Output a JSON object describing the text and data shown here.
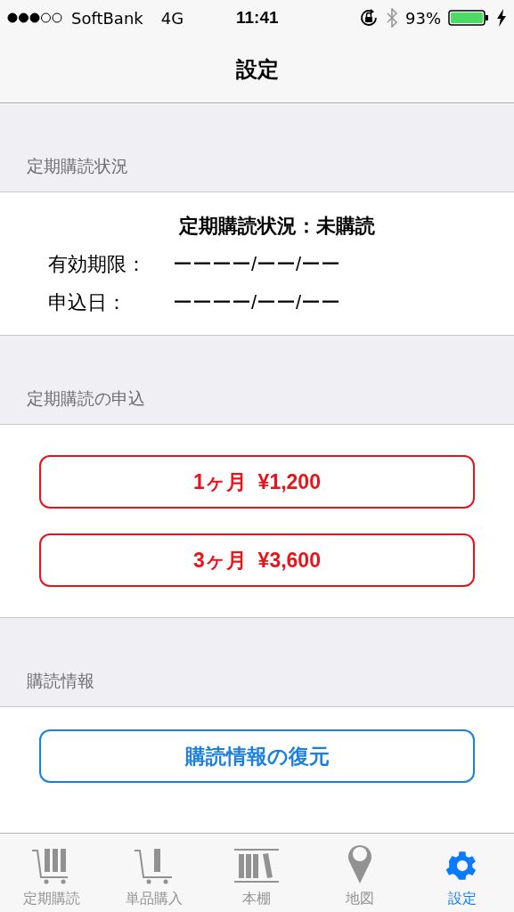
{
  "status_bar": {
    "carrier": "SoftBank",
    "network": "4G",
    "time": "11:41",
    "battery": "93%"
  },
  "nav": {
    "title": "設定"
  },
  "sections": [
    {
      "header": "定期購読状況",
      "kind": "status",
      "title": "定期購読状況：未購読",
      "rows": [
        {
          "label": "有効期限：",
          "value": "ーーーー/ーー/ーー"
        },
        {
          "label": "申込日：",
          "value": "ーーーー/ーー/ーー"
        }
      ]
    },
    {
      "header": "定期購読の申込",
      "kind": "buttons",
      "buttons": [
        {
          "label": "1ヶ月  ¥1,200",
          "color": "#e8141b"
        },
        {
          "label": "3ヶ月  ¥3,600",
          "color": "#e8141b"
        }
      ]
    },
    {
      "header": "購読情報",
      "kind": "buttons",
      "buttons": [
        {
          "label": "購読情報の復元",
          "color": "#1a7fe0"
        }
      ]
    }
  ],
  "tabs": [
    {
      "label": "定期購読",
      "kind": "cart-full",
      "selected": false
    },
    {
      "label": "単品購入",
      "kind": "cart-single",
      "selected": false
    },
    {
      "label": "本棚",
      "kind": "shelf",
      "selected": false
    },
    {
      "label": "地図",
      "kind": "pin",
      "selected": false
    },
    {
      "label": "設定",
      "kind": "gear",
      "selected": true
    }
  ]
}
